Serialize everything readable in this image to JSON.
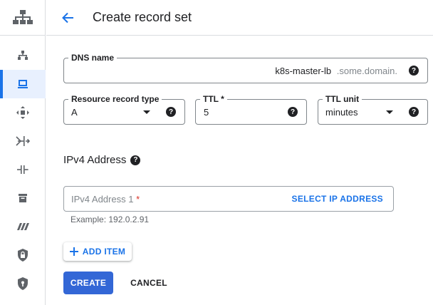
{
  "header": {
    "title": "Create record set"
  },
  "rail": {
    "icons": [
      "network-topology-icon",
      "network-icon",
      "computer-icon",
      "move-icon",
      "route-icon",
      "connectivity-icon",
      "storage-icon",
      "stripes-icon",
      "lock-shield-icon",
      "shield-icon"
    ],
    "active_index": 1
  },
  "form": {
    "dns_name": {
      "label": "DNS name",
      "value": "k8s-master-lb",
      "suffix": ".some.domain."
    },
    "record_type": {
      "label": "Resource record type",
      "value": "A"
    },
    "ttl": {
      "label": "TTL *",
      "value": "5"
    },
    "ttl_unit": {
      "label": "TTL unit",
      "value": "minutes"
    },
    "ipv4_section": {
      "title": "IPv4 Address"
    },
    "ipv4_input": {
      "placeholder": "IPv4 Address 1",
      "required_mark": "*",
      "select_label": "SELECT IP ADDRESS",
      "hint": "Example: 192.0.2.91"
    },
    "add_item_label": "ADD ITEM"
  },
  "actions": {
    "create_label": "CREATE",
    "cancel_label": "CANCEL"
  },
  "colors": {
    "accent": "#1a73e8",
    "primary_button": "#3367d6",
    "required": "#d93025"
  }
}
